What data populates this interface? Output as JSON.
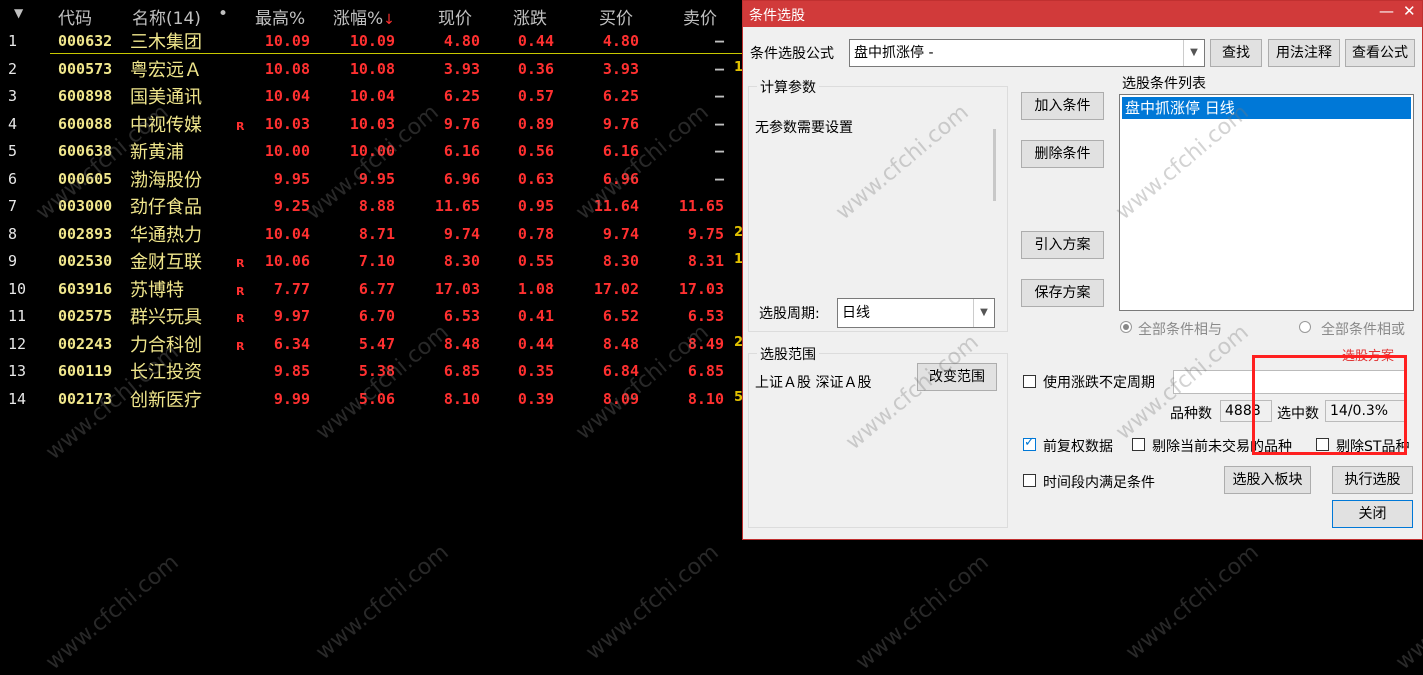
{
  "table": {
    "headers": {
      "code": "代码",
      "name": "名称(14)",
      "dot": "•",
      "high": "最高%",
      "pct": "涨幅%",
      "price": "现价",
      "chg": "涨跌",
      "bid": "买价",
      "ask": "卖价"
    },
    "rows": [
      {
        "idx": "1",
        "code": "000632",
        "name": "三木集团",
        "r": "",
        "high": "10.09",
        "pct": "10.09",
        "price": "4.80",
        "chg": "0.44",
        "bid": "4.80",
        "ask": "—",
        "edge": ""
      },
      {
        "idx": "2",
        "code": "000573",
        "name": "粤宏远Ａ",
        "r": "",
        "high": "10.08",
        "pct": "10.08",
        "price": "3.93",
        "chg": "0.36",
        "bid": "3.93",
        "ask": "—",
        "edge": "1"
      },
      {
        "idx": "3",
        "code": "600898",
        "name": "国美通讯",
        "r": "",
        "high": "10.04",
        "pct": "10.04",
        "price": "6.25",
        "chg": "0.57",
        "bid": "6.25",
        "ask": "—",
        "edge": ""
      },
      {
        "idx": "4",
        "code": "600088",
        "name": "中视传媒",
        "r": "R",
        "high": "10.03",
        "pct": "10.03",
        "price": "9.76",
        "chg": "0.89",
        "bid": "9.76",
        "ask": "—",
        "edge": ""
      },
      {
        "idx": "5",
        "code": "600638",
        "name": "新黄浦",
        "r": "",
        "high": "10.00",
        "pct": "10.00",
        "price": "6.16",
        "chg": "0.56",
        "bid": "6.16",
        "ask": "—",
        "edge": ""
      },
      {
        "idx": "6",
        "code": "000605",
        "name": "渤海股份",
        "r": "",
        "high": "9.95",
        "pct": "9.95",
        "price": "6.96",
        "chg": "0.63",
        "bid": "6.96",
        "ask": "—",
        "edge": ""
      },
      {
        "idx": "7",
        "code": "003000",
        "name": "劲仔食品",
        "r": "",
        "high": "9.25",
        "pct": "8.88",
        "price": "11.65",
        "chg": "0.95",
        "bid": "11.64",
        "ask": "11.65",
        "edge": ""
      },
      {
        "idx": "8",
        "code": "002893",
        "name": "华通热力",
        "r": "",
        "high": "10.04",
        "pct": "8.71",
        "price": "9.74",
        "chg": "0.78",
        "bid": "9.74",
        "ask": "9.75",
        "edge": "2"
      },
      {
        "idx": "9",
        "code": "002530",
        "name": "金财互联",
        "r": "R",
        "high": "10.06",
        "pct": "7.10",
        "price": "8.30",
        "chg": "0.55",
        "bid": "8.30",
        "ask": "8.31",
        "edge": "1"
      },
      {
        "idx": "10",
        "code": "603916",
        "name": "苏博特",
        "r": "R",
        "high": "7.77",
        "pct": "6.77",
        "price": "17.03",
        "chg": "1.08",
        "bid": "17.02",
        "ask": "17.03",
        "edge": ""
      },
      {
        "idx": "11",
        "code": "002575",
        "name": "群兴玩具",
        "r": "R",
        "high": "9.97",
        "pct": "6.70",
        "price": "6.53",
        "chg": "0.41",
        "bid": "6.52",
        "ask": "6.53",
        "edge": ""
      },
      {
        "idx": "12",
        "code": "002243",
        "name": "力合科创",
        "r": "R",
        "high": "6.34",
        "pct": "5.47",
        "price": "8.48",
        "chg": "0.44",
        "bid": "8.48",
        "ask": "8.49",
        "edge": "2"
      },
      {
        "idx": "13",
        "code": "600119",
        "name": "长江投资",
        "r": "",
        "high": "9.85",
        "pct": "5.38",
        "price": "6.85",
        "chg": "0.35",
        "bid": "6.84",
        "ask": "6.85",
        "edge": ""
      },
      {
        "idx": "14",
        "code": "002173",
        "name": "创新医疗",
        "r": "",
        "high": "9.99",
        "pct": "5.06",
        "price": "8.10",
        "chg": "0.39",
        "bid": "8.09",
        "ask": "8.10",
        "edge": "5"
      }
    ],
    "watermark": "www.cfchi.com"
  },
  "dialog": {
    "title": "条件选股",
    "formula_label": "条件选股公式",
    "formula_value": "盘中抓涨停   -",
    "find_btn": "查找",
    "usage_btn": "用法注释",
    "view_btn": "查看公式",
    "calc_group": "计算参数",
    "no_params": "无参数需要设置",
    "add_cond_btn": "加入条件",
    "del_cond_btn": "删除条件",
    "import_btn": "引入方案",
    "save_btn": "保存方案",
    "cond_list_label": "选股条件列表",
    "cond_list_items": [
      "盘中抓涨停  日线"
    ],
    "period_label": "选股周期:",
    "period_value": "日线",
    "radio_and": "全部条件相与",
    "radio_or": "全部条件相或",
    "range_group": "选股范围",
    "range_value": "上证Ａ股 深证Ａ股",
    "change_range_btn": "改变范围",
    "red_hint": "选股方案",
    "use_period_label": "使用涨跌不定周期",
    "count_label": "品种数",
    "count_value": "4888",
    "selected_label": "选中数",
    "selected_value": "14/0.3%",
    "fq_label": "前复权数据",
    "exclude_no_trade": "剔除当前未交易的品种",
    "exclude_st": "剔除ST品种",
    "time_window": "时间段内满足条件",
    "to_block_btn": "选股入板块",
    "exec_btn": "执行选股",
    "close_btn": "关闭",
    "min_icon": "—",
    "close_icon": "✕"
  }
}
